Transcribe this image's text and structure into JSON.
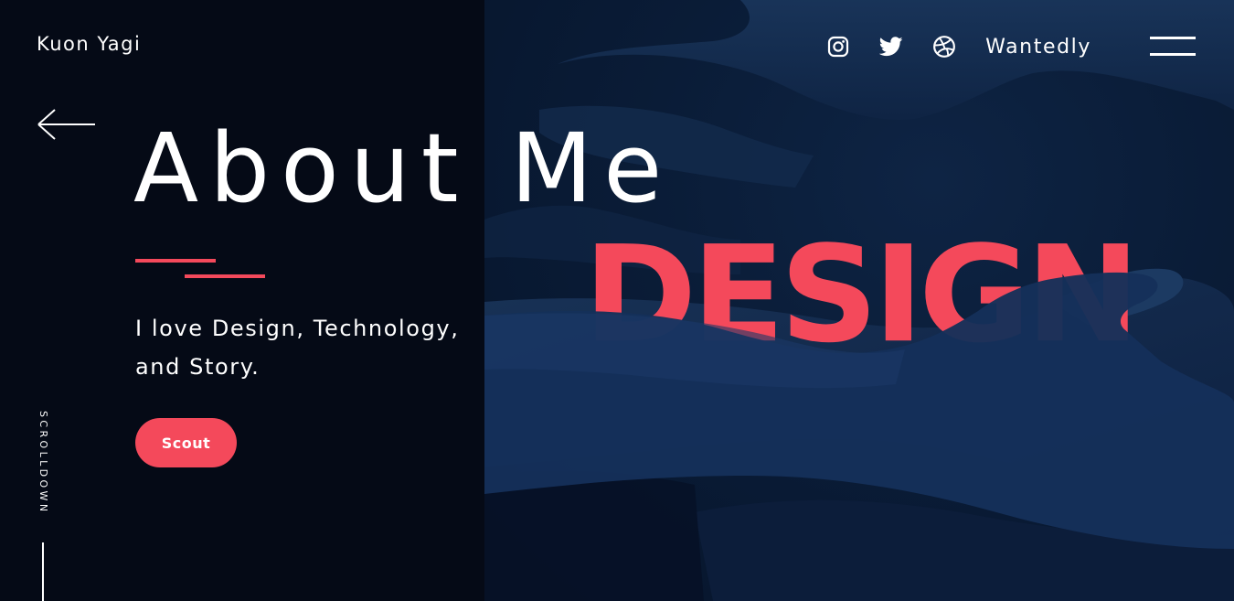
{
  "brand": {
    "name": "Kuon Yagi"
  },
  "nav": {
    "social": [
      {
        "icon": "instagram-icon"
      },
      {
        "icon": "twitter-icon"
      },
      {
        "icon": "dribbble-icon"
      }
    ],
    "wantedly_label": "Wantedly",
    "menu_icon": "hamburger-menu-icon"
  },
  "hero": {
    "title": "About Me",
    "tagline_line1": "I love Design, Technology,",
    "tagline_line2": "and Story.",
    "cta_label": "Scout",
    "back_icon": "arrow-left-icon",
    "image_word": "DESIGN"
  },
  "scroll": {
    "label": "SCROLLDOWN"
  },
  "colors": {
    "accent": "#f4495b",
    "background": "#050a16",
    "image_tint": "#0a1c37",
    "text": "#ffffff"
  }
}
